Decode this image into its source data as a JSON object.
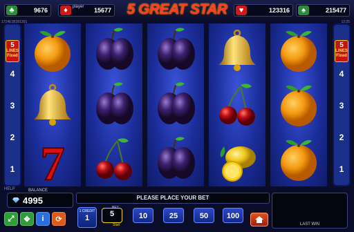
{
  "header": {
    "title": "5 GREAT STAR",
    "jackpots": [
      {
        "suit": "clubs",
        "symbol": "♣",
        "value": "9676",
        "color": "#2e8b3a"
      },
      {
        "suit": "diamonds",
        "symbol": "♦",
        "value": "15677",
        "player_tag": "player",
        "color": "#d01818"
      },
      {
        "suit": "hearts",
        "symbol": "♥",
        "value": "123316",
        "color": "#d01818"
      },
      {
        "suit": "spades",
        "symbol": "♠",
        "value": "215477",
        "color": "#2e8b3a"
      }
    ],
    "session_id": "1724E1B391351",
    "clock": "12:25"
  },
  "lines": {
    "badge_top": "5",
    "badge_mid": "LINES",
    "badge_bot": "Fixed",
    "numbers": [
      "4",
      "3",
      "2",
      "1"
    ]
  },
  "reels": [
    [
      "orange",
      "bell",
      "seven"
    ],
    [
      "plum",
      "plum",
      "cherry"
    ],
    [
      "plum",
      "plum",
      "plum"
    ],
    [
      "bell",
      "cherry",
      "lemon"
    ],
    [
      "orange",
      "orange",
      "orange"
    ]
  ],
  "footer": {
    "help_label": "HELP",
    "balance_label": "BALANCE",
    "balance_value": "4995",
    "message": "PLEASE PLACE YOUR BET",
    "credit_label": "1 CREDIT",
    "credit_value": "1",
    "bet_label": "BET",
    "start_label": "Start",
    "bets": [
      "5",
      "10",
      "25",
      "50",
      "100"
    ],
    "last_win_label": "LAST WIN",
    "buttons": [
      {
        "name": "fullscreen-icon",
        "glyph": "⤢",
        "color": "#2f9e3a"
      },
      {
        "name": "expand-icon",
        "glyph": "✥",
        "color": "#2f9e3a"
      },
      {
        "name": "info-icon",
        "glyph": "i",
        "color": "#2a6fe0"
      },
      {
        "name": "autoplay-icon",
        "glyph": "⟳",
        "color": "#e05a14"
      }
    ]
  },
  "colors": {
    "reel": "#1b2d9a",
    "title": "#ff3a2a",
    "accent": "#ffd700"
  }
}
